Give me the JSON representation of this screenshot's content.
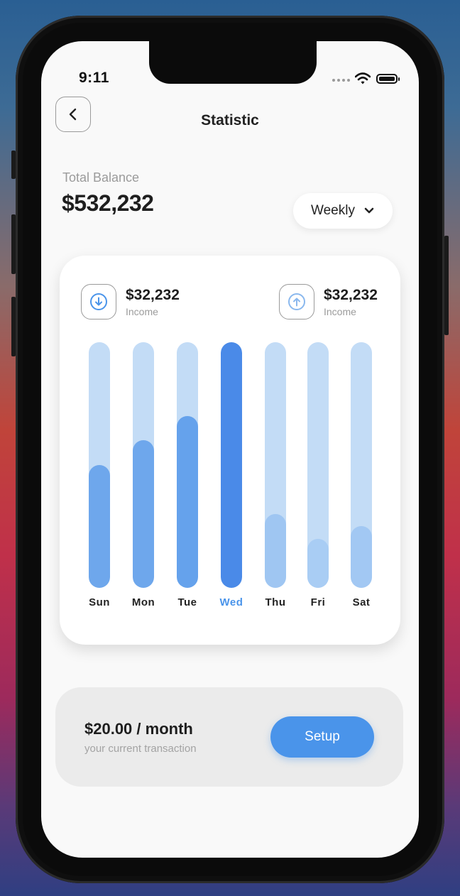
{
  "status_bar": {
    "time": "9:11"
  },
  "header": {
    "title": "Statistic"
  },
  "balance": {
    "label": "Total Balance",
    "value": "$532,232"
  },
  "period_select": {
    "selected": "Weekly"
  },
  "summary": [
    {
      "amount": "$32,232",
      "label": "Income",
      "icon": "arrow-down-circle-icon",
      "color": "#4a94ea"
    },
    {
      "amount": "$32,232",
      "label": "Income",
      "icon": "arrow-up-circle-icon",
      "color": "#8ab8ee"
    }
  ],
  "weekly_chart": {
    "active_day": "Wed",
    "active_color": "#4a94ea",
    "track_color": "#c3dcf6",
    "days": [
      {
        "label": "Sun",
        "value": 0.5,
        "color": "#6ea7ec"
      },
      {
        "label": "Mon",
        "value": 0.6,
        "color": "#6ea7ec"
      },
      {
        "label": "Tue",
        "value": 0.7,
        "color": "#65a2ec"
      },
      {
        "label": "Wed",
        "value": 1.0,
        "color": "#4a8ae8"
      },
      {
        "label": "Thu",
        "value": 0.3,
        "color": "#9fc6f2"
      },
      {
        "label": "Fri",
        "value": 0.2,
        "color": "#a9cdf4"
      },
      {
        "label": "Sat",
        "value": 0.25,
        "color": "#a2c8f3"
      }
    ]
  },
  "subscription": {
    "price": "$20.00 / month",
    "caption": "your current transaction",
    "button_label": "Setup"
  }
}
